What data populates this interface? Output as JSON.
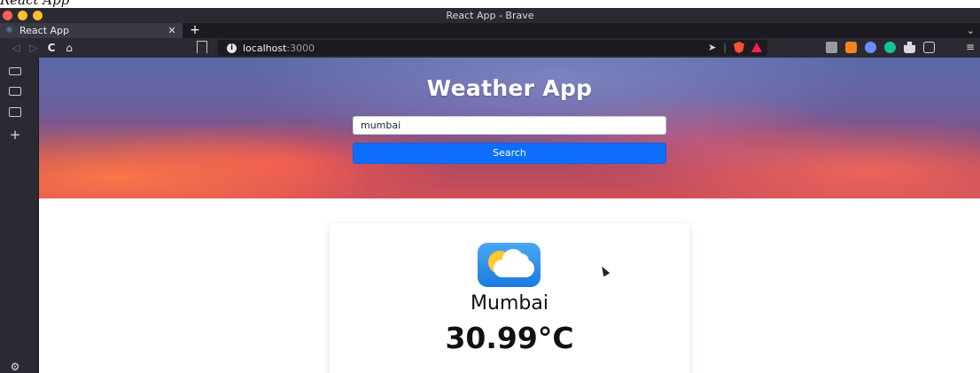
{
  "caption": "React App",
  "window": {
    "title": "React App - Brave"
  },
  "tabs": [
    {
      "label": "React App",
      "favicon": "react-icon",
      "active": true
    }
  ],
  "tabstrip": {
    "new_tab": "+",
    "list": "⌄"
  },
  "nav": {
    "back": "◁",
    "forward": "▷",
    "reload": "C",
    "home": "⌂"
  },
  "urlbar": {
    "host": "localhost",
    "port": ":3000",
    "share_icon": "➤",
    "divider": "|"
  },
  "extensions": [
    {
      "name": "camera-icon",
      "color": "#9b9aa3"
    },
    {
      "name": "metamask-icon",
      "color": "#f6851b"
    },
    {
      "name": "eye-icon",
      "color": "#6b8cff"
    },
    {
      "name": "grammarly-icon",
      "color": "#15c39a"
    },
    {
      "name": "puzzle-icon",
      "color": "#d8d8de"
    },
    {
      "name": "wallet-icon",
      "color": "#d8d8de"
    }
  ],
  "menu": "≡",
  "sidebar": {
    "add": "+",
    "settings": "⚙"
  },
  "page": {
    "title": "Weather App",
    "search": {
      "value": "mumbai",
      "button_label": "Search"
    },
    "weather": {
      "icon": "partly-cloudy-icon",
      "city": "Mumbai",
      "temperature": "30.99°C"
    }
  },
  "colors": {
    "chrome_bg": "#2b2a33",
    "tab_bg": "#3b3a44",
    "button_primary": "#0d6efd"
  }
}
